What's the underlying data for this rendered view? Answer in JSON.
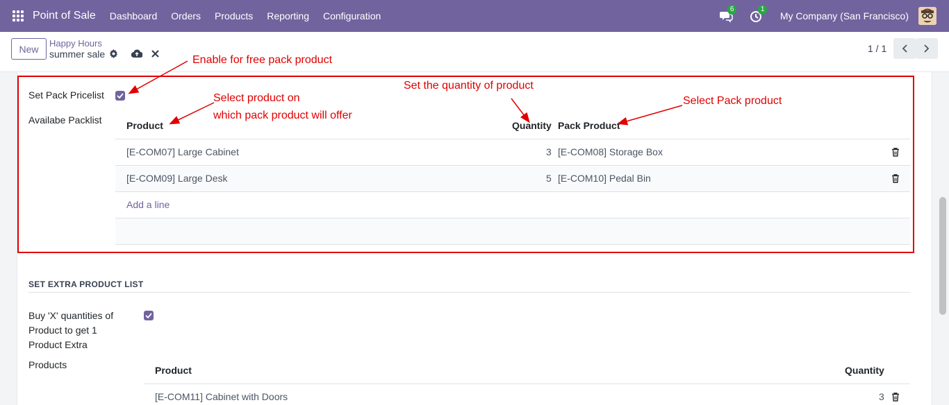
{
  "navbar": {
    "brand": "Point of Sale",
    "menu": [
      "Dashboard",
      "Orders",
      "Products",
      "Reporting",
      "Configuration"
    ],
    "messages_count": "6",
    "activities_count": "1",
    "company": "My Company (San Francisco)"
  },
  "control": {
    "new_label": "New",
    "breadcrumb_parent": "Happy Hours",
    "breadcrumb_current": "summer sale",
    "pager": "1 / 1"
  },
  "pack": {
    "set_pack_label": "Set Pack Pricelist",
    "set_pack_checked": true,
    "available_label": "Availabe Packlist",
    "columns": {
      "product": "Product",
      "quantity": "Quantity",
      "pack_product": "Pack Product"
    },
    "rows": [
      {
        "product": "[E-COM07] Large Cabinet",
        "quantity": "3",
        "pack_product": "[E-COM08] Storage Box"
      },
      {
        "product": "[E-COM09] Large Desk",
        "quantity": "5",
        "pack_product": "[E-COM10] Pedal Bin"
      }
    ],
    "add_line": "Add a line"
  },
  "extra": {
    "section_title": "SET EXTRA PRODUCT LIST",
    "buy_label_1": "Buy 'X' quantities of",
    "buy_label_2": "Product to get 1",
    "buy_label_3": "Product Extra",
    "buy_checked": true,
    "products_label": "Products",
    "columns": {
      "product": "Product",
      "quantity": "Quantity"
    },
    "rows": [
      {
        "product": "[E-COM11] Cabinet with Doors",
        "quantity": "3"
      }
    ]
  },
  "annotations": {
    "enable": "Enable for free pack product",
    "select_product_1": "Select product on",
    "select_product_2": "which pack product will offer",
    "set_quantity": "Set the quantity of product",
    "select_pack": "Select Pack product"
  },
  "colors": {
    "navbar": "#71639e",
    "accent": "#71639e",
    "annotation": "#e00000"
  }
}
